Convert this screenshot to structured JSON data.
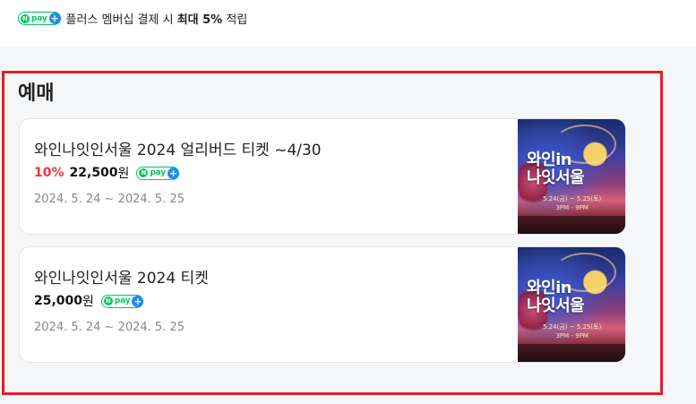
{
  "npay_banner": {
    "badge_n": "N",
    "badge_word": "pay",
    "badge_plus": "+",
    "text_prefix": "플러스 멤버십 결제 시 ",
    "text_bold": "최대 5%",
    "text_suffix": " 적립"
  },
  "section": {
    "title": "예매"
  },
  "items": [
    {
      "title": "와인나잇인서울 2024 얼리버드 티켓 ~4/30",
      "discount": "10%",
      "price": "22,500",
      "currency": "원",
      "date": "2024. 5. 24 ~ 2024. 5. 25",
      "thumb_title_line1": "와인in",
      "thumb_title_line2": "나잇서울",
      "thumb_info": "5.24(금) ~ 5.25(토)\n3PM - 9PM"
    },
    {
      "title": "와인나잇인서울 2024 티켓",
      "discount": "",
      "price": "25,000",
      "currency": "원",
      "date": "2024. 5. 24 ~ 2024. 5. 25",
      "thumb_title_line1": "와인in",
      "thumb_title_line2": "나잇서울",
      "thumb_info": "5.24(금) ~ 5.25(토)\n3PM - 9PM"
    }
  ],
  "colors": {
    "npay_green": "#03c75a",
    "npay_plus_blue": "#1e8cf0",
    "discount_red": "#f2333a",
    "highlight_red": "#e41e26"
  },
  "icons": {
    "npay_badge": "npay-plus-logo"
  }
}
